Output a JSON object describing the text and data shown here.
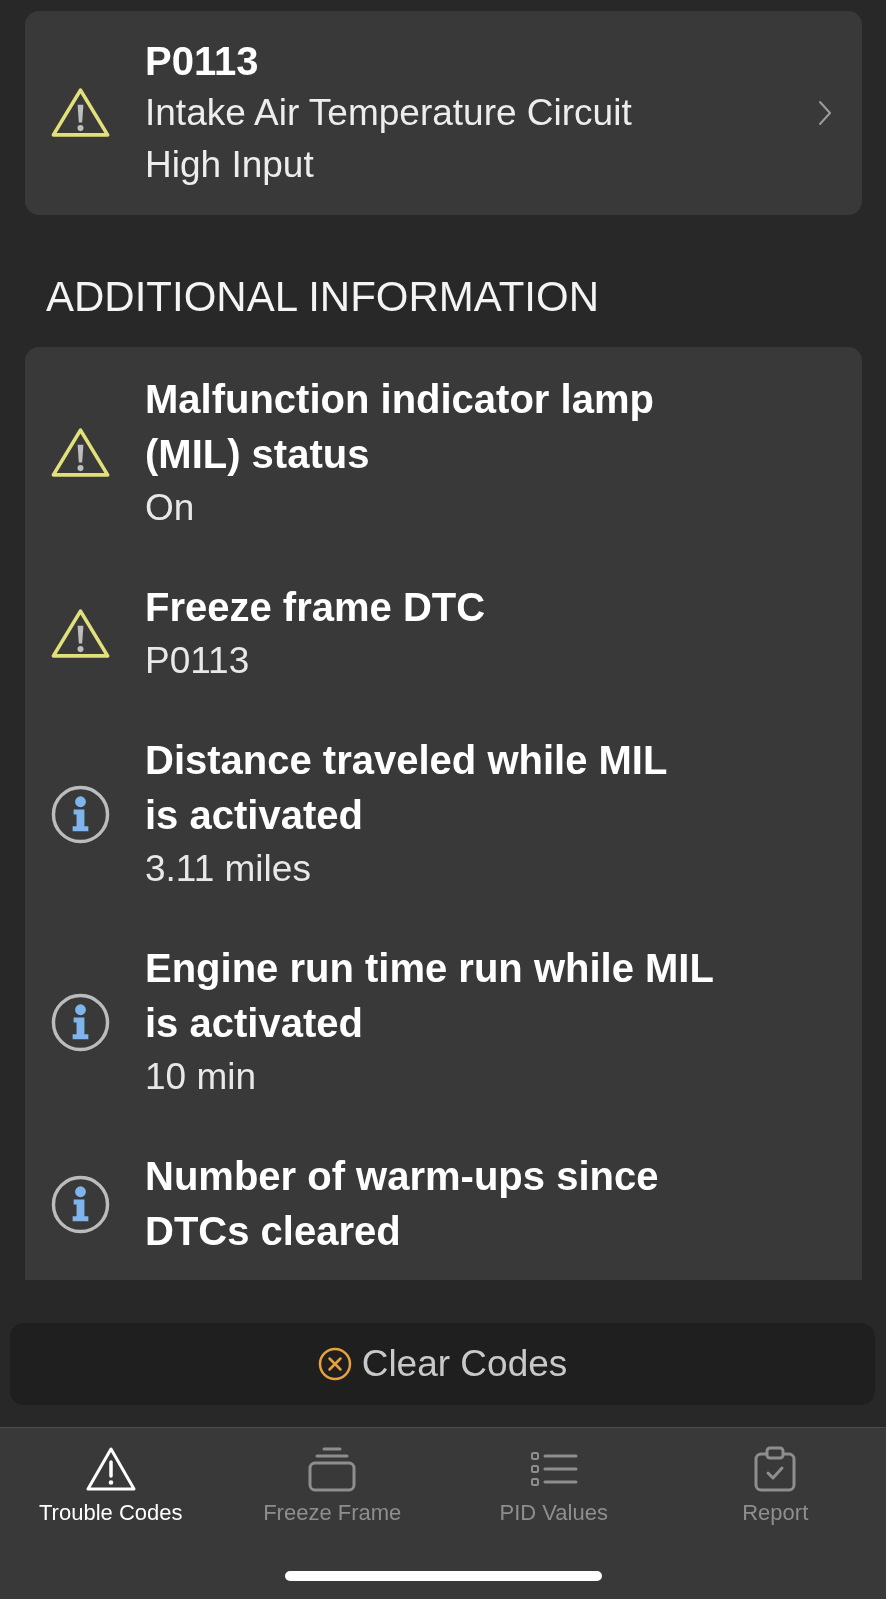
{
  "trouble_codes": [
    {
      "kind": "warning",
      "code": "P0113",
      "description": "Intake Air Temperature Circuit High Input"
    }
  ],
  "additional_information": {
    "heading": "ADDITIONAL INFORMATION",
    "items": [
      {
        "kind": "warning",
        "title": "Malfunction indicator lamp\n(MIL) status",
        "value": "On"
      },
      {
        "kind": "warning",
        "title": "Freeze frame DTC",
        "value": "P0113"
      },
      {
        "kind": "info",
        "title": "Distance traveled while MIL\nis activated",
        "value": "3.11 miles"
      },
      {
        "kind": "info",
        "title": "Engine run time run while MIL\nis activated",
        "value": "10 min"
      },
      {
        "kind": "info",
        "title": "Number of warm-ups since\nDTCs cleared"
      }
    ]
  },
  "clear_button": {
    "label": "Clear Codes"
  },
  "tab_bar": [
    {
      "label": "Trouble Codes",
      "selected": true
    },
    {
      "label": "Freeze Frame",
      "selected": false
    },
    {
      "label": "PID Values",
      "selected": false
    },
    {
      "label": "Report",
      "selected": false
    }
  ]
}
